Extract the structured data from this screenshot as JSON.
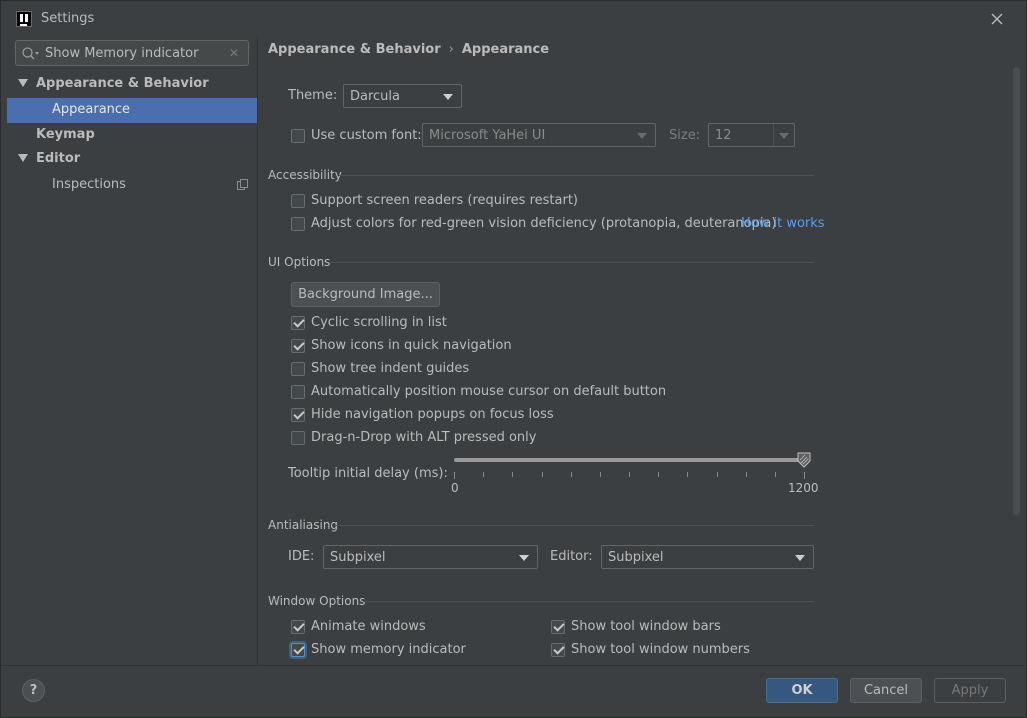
{
  "window": {
    "title": "Settings"
  },
  "search": {
    "value": "Show Memory indicator"
  },
  "sidebar": {
    "items": [
      {
        "label": "Appearance & Behavior"
      },
      {
        "label": "Appearance"
      },
      {
        "label": "Keymap"
      },
      {
        "label": "Editor"
      },
      {
        "label": "Inspections"
      }
    ]
  },
  "breadcrumb": {
    "parent": "Appearance & Behavior",
    "separator": "›",
    "current": "Appearance"
  },
  "theme": {
    "label": "Theme:",
    "value": "Darcula"
  },
  "custom_font": {
    "label": "Use custom font:",
    "checked": false,
    "font_value": "Microsoft YaHei UI",
    "size_label": "Size:",
    "size_value": "12"
  },
  "accessibility": {
    "title": "Accessibility",
    "screen_readers": {
      "label": "Support screen readers (requires restart)",
      "checked": false
    },
    "color_deficiency": {
      "label": "Adjust colors for red-green vision deficiency (protanopia, deuteranopia)",
      "checked": false
    },
    "how_it_works": "How it works"
  },
  "ui_options": {
    "title": "UI Options",
    "background_button": "Background Image...",
    "checkboxes": [
      {
        "label": "Cyclic scrolling in list",
        "checked": true
      },
      {
        "label": "Show icons in quick navigation",
        "checked": true
      },
      {
        "label": "Show tree indent guides",
        "checked": false
      },
      {
        "label": "Automatically position mouse cursor on default button",
        "checked": false
      },
      {
        "label": "Hide navigation popups on focus loss",
        "checked": true
      },
      {
        "label": "Drag-n-Drop with ALT pressed only",
        "checked": false
      }
    ],
    "tooltip_label": "Tooltip initial delay (ms):",
    "tooltip_min": "0",
    "tooltip_max": "1200",
    "tooltip_value": 1200
  },
  "antialiasing": {
    "title": "Antialiasing",
    "ide_label": "IDE:",
    "ide_value": "Subpixel",
    "editor_label": "Editor:",
    "editor_value": "Subpixel"
  },
  "window_options": {
    "title": "Window Options",
    "animate_windows": {
      "label": "Animate windows",
      "checked": true
    },
    "show_memory": {
      "label": "Show memory indicator",
      "checked": true
    },
    "tool_window_bars": {
      "label": "Show tool window bars",
      "checked": true
    },
    "tool_window_numbers": {
      "label": "Show tool window numbers",
      "checked": true
    }
  },
  "footer": {
    "help": "?",
    "ok": "OK",
    "cancel": "Cancel",
    "apply": "Apply"
  },
  "colors": {
    "background": "#3c3f41",
    "selection": "#4b6eaf",
    "link": "#589df6",
    "primary_button": "#365880"
  }
}
